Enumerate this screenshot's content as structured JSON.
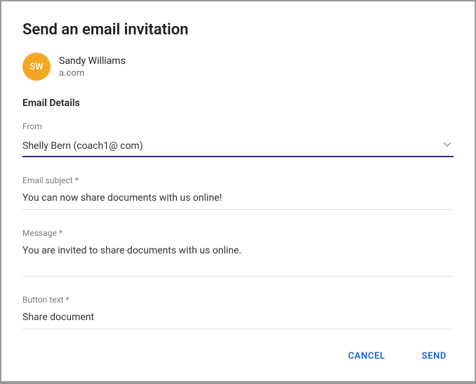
{
  "dialog": {
    "title": "Send an email invitation"
  },
  "recipient": {
    "initials": "SW",
    "name": "Sandy Williams",
    "email": "a.com"
  },
  "section": {
    "heading": "Email Details"
  },
  "from": {
    "label": "From",
    "value": "Shelly Bern (coach1@        com)"
  },
  "subject": {
    "label": "Email subject *",
    "value": "You can now share documents with us online!"
  },
  "message": {
    "label": "Message *",
    "value": "You are invited to share documents with us online."
  },
  "buttonText": {
    "label": "Button text *",
    "value": "Share document"
  },
  "actions": {
    "cancel": "CANCEL",
    "send": "SEND"
  }
}
